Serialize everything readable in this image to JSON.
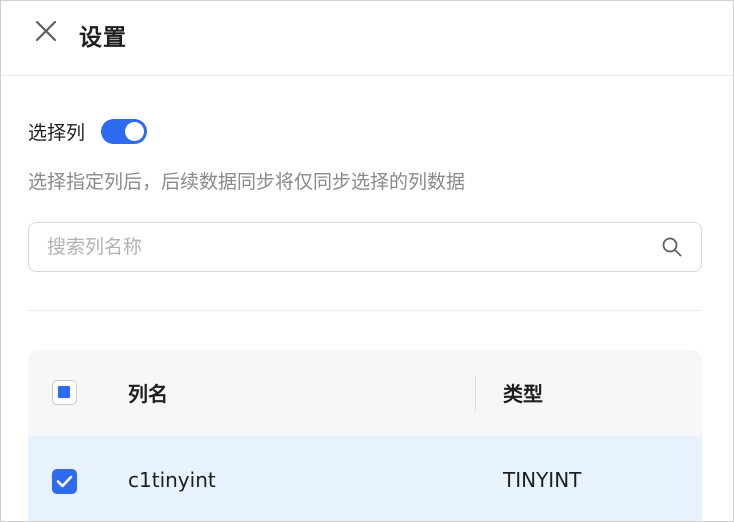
{
  "header": {
    "title": "设置",
    "close_icon": "close-icon"
  },
  "column_select": {
    "label": "选择列",
    "toggle_on": true,
    "accent_color": "#2f6bf0",
    "description": "选择指定列后，后续数据同步将仅同步选择的列数据"
  },
  "search": {
    "placeholder": "搜索列名称",
    "value": "",
    "icon": "search-icon"
  },
  "table": {
    "header_checkbox_state": "indeterminate",
    "columns": [
      "列名",
      "类型"
    ],
    "rows": [
      {
        "checked": true,
        "name": "c1tinyint",
        "type": "TINYINT"
      }
    ]
  }
}
